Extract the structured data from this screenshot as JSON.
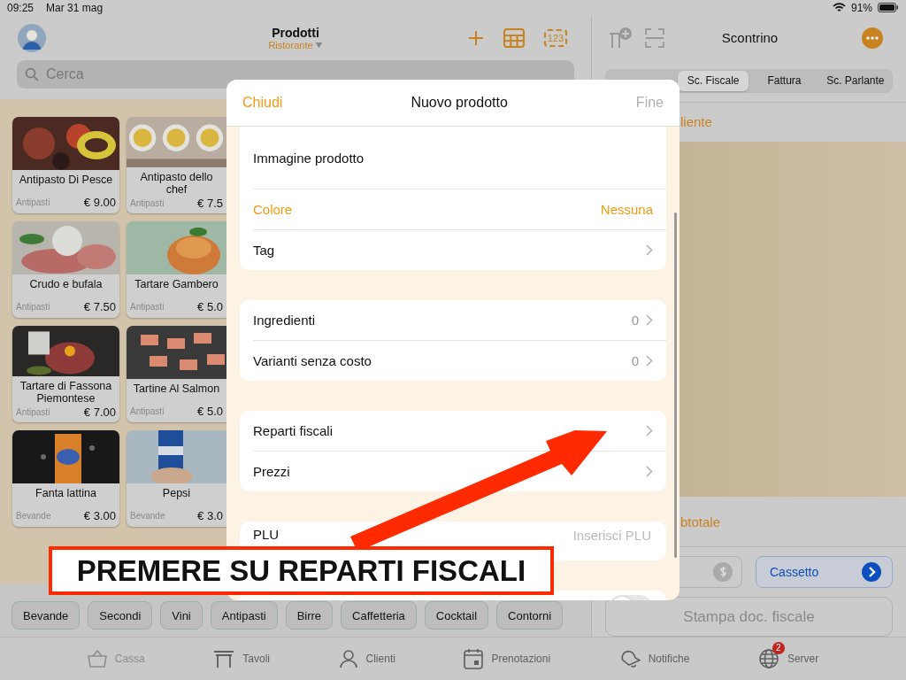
{
  "status_bar": {
    "time": "09:25",
    "date": "Mar 31 mag",
    "battery": "91%"
  },
  "products_panel": {
    "title": "Prodotti",
    "venue": "Ristorante",
    "keypad_label": "123",
    "search": {
      "placeholder": "Cerca"
    },
    "products": [
      {
        "name": "Antipasto Di Pesce",
        "category": "Antipasti",
        "price": "€ 9.00"
      },
      {
        "name": "Antipasto dello chef",
        "category": "Antipasti",
        "price": "€ 7.5"
      },
      {
        "name": "Crudo e bufala",
        "category": "Antipasti",
        "price": "€ 7.50"
      },
      {
        "name": "Tartare Gambero",
        "category": "Antipasti",
        "price": "€ 5.0"
      },
      {
        "name": "Tartare di Fassona Piemontese",
        "category": "Antipasti",
        "price": "€ 7.00"
      },
      {
        "name": "Tartine Al Salmon",
        "category": "Antipasti",
        "price": "€ 5.0"
      },
      {
        "name": "Fanta lattina",
        "category": "Bevande",
        "price": "€ 3.00"
      },
      {
        "name": "Pepsi",
        "category": "Bevande",
        "price": "€ 3.0"
      }
    ],
    "categories": [
      "Bevande",
      "Secondi",
      "Vini",
      "Antipasti",
      "Birre",
      "Caffetteria",
      "Cocktail",
      "Contorni"
    ]
  },
  "receipt_panel": {
    "title": "Scontrino",
    "tabs": [
      {
        "label": "Sc. Fiscale",
        "selected": true
      },
      {
        "label": "Fattura",
        "selected": false
      },
      {
        "label": "Sc. Parlante",
        "selected": false
      }
    ],
    "customer": "liente",
    "subtotal": "btotale",
    "drawer_button": "Cassetto",
    "print_button": {
      "label": "Stampa doc. fiscale",
      "disabled": true
    }
  },
  "modal": {
    "close": "Chiudi",
    "title": "Nuovo prodotto",
    "done": {
      "label": "Fine",
      "disabled": true
    },
    "sections": [
      [
        {
          "label": "Immagine prodotto"
        },
        {
          "kind": "option",
          "label": "Colore",
          "value": "Nessuna"
        },
        {
          "kind": "link",
          "label": "Tag"
        }
      ],
      [
        {
          "kind": "link",
          "label": "Ingredienti",
          "value": "0"
        },
        {
          "kind": "link",
          "label": "Varianti senza costo",
          "value": "0"
        }
      ],
      [
        {
          "kind": "link",
          "label": "Reparti fiscali"
        },
        {
          "kind": "link",
          "label": "Prezzi"
        }
      ],
      [
        {
          "kind": "input",
          "label": "PLU",
          "placeholder": "Inserisci PLU"
        }
      ],
      [
        {
          "kind": "toggle",
          "on": false
        }
      ]
    ]
  },
  "annotation": "PREMERE SU REPARTI FISCALI",
  "tab_bar": [
    {
      "label": "Cassa",
      "selected": true
    },
    {
      "label": "Tavoli",
      "selected": false
    },
    {
      "label": "Clienti",
      "selected": false
    },
    {
      "label": "Prenotazioni",
      "selected": false
    },
    {
      "label": "Notifiche",
      "selected": false
    },
    {
      "label": "Server",
      "selected": false,
      "badge": "2"
    }
  ]
}
